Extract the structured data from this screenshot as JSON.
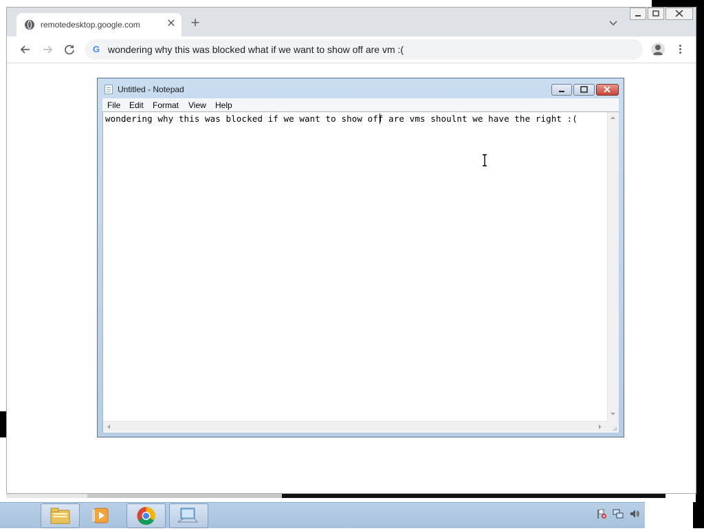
{
  "browser": {
    "tab": {
      "title": "remotedesktop.google.com",
      "close_icon": "close-icon"
    },
    "new_tab_icon": "plus-icon",
    "tab_search_icon": "chevron-down-icon",
    "window_controls": [
      "minimize",
      "restore",
      "close"
    ],
    "toolbar": {
      "back_icon": "arrow-left-icon",
      "forward_icon": "arrow-right-icon",
      "reload_icon": "reload-icon",
      "search_engine_icon": "google-g-icon",
      "address_text": "wondering why this was blocked what if we want to show off are vm :(",
      "profile_icon": "profile-icon",
      "menu_icon": "kebab-menu-icon"
    }
  },
  "notepad": {
    "title": "Untitled - Notepad",
    "menus": [
      "File",
      "Edit",
      "Format",
      "View",
      "Help"
    ],
    "content": "wondering why this was blocked if we want to show off are vms shoulnt we have the right :(",
    "buttons": [
      "minimize",
      "maximize",
      "close"
    ]
  },
  "taskbar": {
    "items": [
      {
        "name": "explorer",
        "icon": "folder-icon",
        "active": true
      },
      {
        "name": "media-player",
        "icon": "media-player-icon",
        "active": false
      },
      {
        "name": "chrome",
        "icon": "chrome-icon",
        "active": true
      },
      {
        "name": "remote-desktop",
        "icon": "computer-icon",
        "active": true
      }
    ],
    "tray_icons": [
      "action-center-flag-icon",
      "network-icon",
      "volume-icon"
    ]
  },
  "colors": {
    "chrome_tabstrip": "#dee1e6",
    "omnibox": "#f1f3f4",
    "notepad_frame": "#c9dcf0",
    "close_red": "#c7463a",
    "taskbar": "#b8cfe6"
  }
}
